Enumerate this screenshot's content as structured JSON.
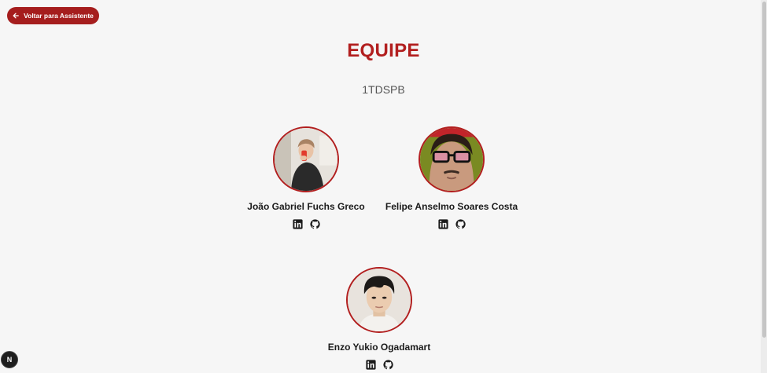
{
  "back_button": {
    "label": "Voltar para Assistente",
    "icon": "arrow-left-icon"
  },
  "page": {
    "title": "EQUIPE",
    "subtitle": "1TDSPB"
  },
  "members": [
    {
      "name": "João Gabriel Fuchs Greco",
      "links": [
        "linkedin-icon",
        "github-icon"
      ]
    },
    {
      "name": "Felipe Anselmo Soares Costa",
      "links": [
        "linkedin-icon",
        "github-icon"
      ]
    },
    {
      "name": "Enzo Yukio Ogadamart",
      "links": [
        "linkedin-icon",
        "github-icon"
      ]
    }
  ],
  "dev_badge": {
    "label": "N"
  },
  "colors": {
    "accent": "#b21f1f",
    "button": "#a51d1d",
    "background": "#f6f6f6"
  }
}
